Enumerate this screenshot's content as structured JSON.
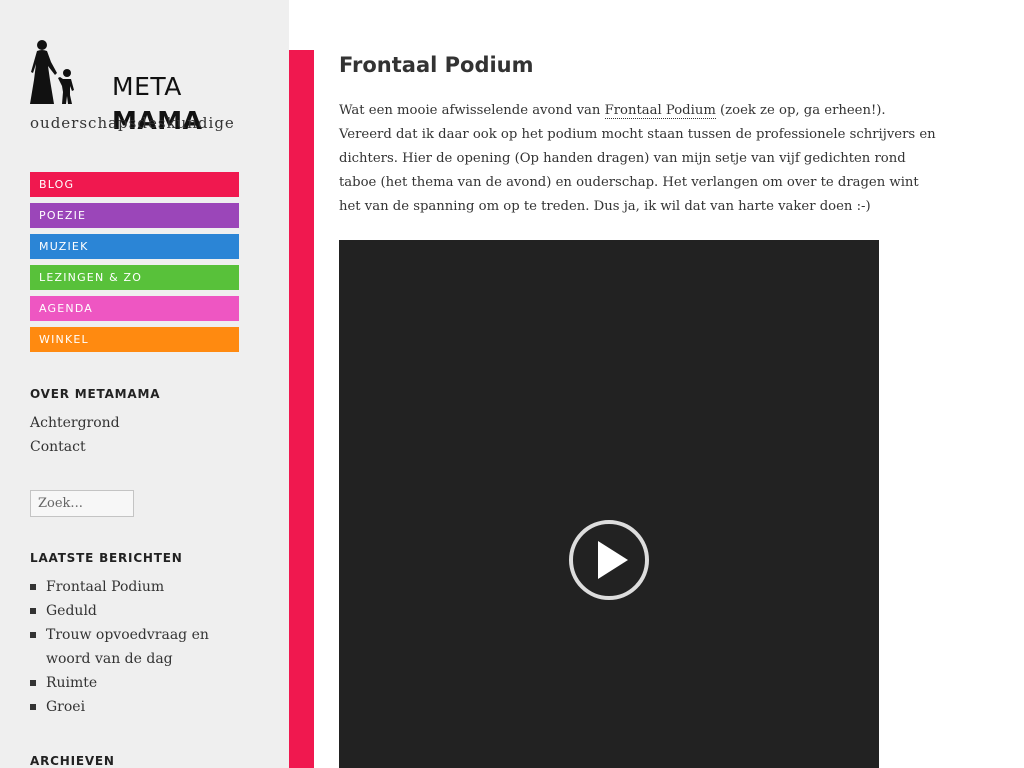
{
  "site": {
    "logo_meta": "META",
    "logo_mama": "MAMA",
    "tagline": "ouderschapsdeskundige"
  },
  "nav": [
    {
      "label": "BLOG",
      "color": "#f0184f"
    },
    {
      "label": "POEZIE",
      "color": "#9b46b9"
    },
    {
      "label": "MUZIEK",
      "color": "#2b85d6"
    },
    {
      "label": "LEZINGEN & ZO",
      "color": "#58c13a"
    },
    {
      "label": "AGENDA",
      "color": "#ee56c2"
    },
    {
      "label": "WINKEL",
      "color": "#ff8a10"
    }
  ],
  "about": {
    "title": "OVER METAMAMA",
    "links": [
      "Achtergrond",
      "Contact"
    ]
  },
  "search": {
    "placeholder": "Zoek..."
  },
  "recent": {
    "title": "LAATSTE BERICHTEN",
    "items": [
      "Frontaal Podium",
      "Geduld",
      "Trouw opvoedvraag en woord van de dag",
      "Ruimte",
      "Groei"
    ]
  },
  "archive": {
    "title": "ARCHIEVEN"
  },
  "post": {
    "title": "Frontaal Podium",
    "body_before": "Wat een mooie afwisselende avond van ",
    "body_link": "Frontaal Podium",
    "body_after": " (zoek ze op, ga erheen!). Vereerd dat ik daar ook op het podium mocht staan tussen de professionele schrijvers en dichters. Hier de opening (Op handen dragen) van mijn setje van vijf gedichten rond taboe (het thema van de avond) en ouderschap. Het verlangen om over te dragen wint het van de spanning om op te treden. Dus ja, ik wil dat van harte vaker doen :-)"
  },
  "video": {
    "play_icon": "play-icon"
  },
  "colors": {
    "accent": "#f0184f",
    "sidebar_bg": "#efefef",
    "video_bg": "#222222"
  }
}
